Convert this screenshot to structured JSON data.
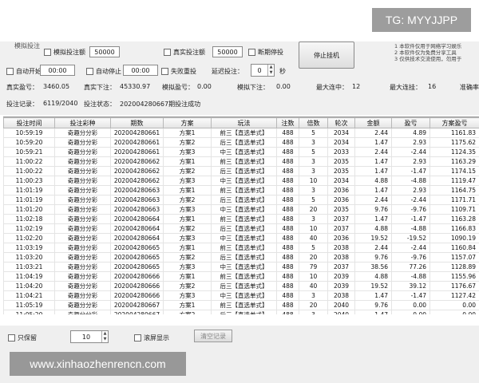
{
  "controls": {
    "top_cut_label": "模拟投注",
    "sim_bet_label": "模拟投注额",
    "sim_bet_value": "50000",
    "real_bet_label": "真实投注额",
    "real_bet_value": "50000",
    "stop_on_break_label": "断期停投",
    "auto_start_label": "自动开始",
    "auto_start_time": "00:00",
    "auto_stop_label": "自动停止",
    "auto_stop_time": "00:00",
    "fail_reset_label": "失败重投",
    "delay_label": "延迟投注：",
    "delay_value": "0",
    "delay_unit": "秒",
    "stop_button": "停止挂机"
  },
  "notes": [
    "1 本软件仅用于网络学习娱乐",
    "2 本软件仅为免费分享工具",
    "3 仅供技术交流使用，勿用于"
  ],
  "stats": {
    "real_profit_label": "真实盈亏：",
    "real_profit": "3460.05",
    "real_bet_label": "真实下注：",
    "real_bet": "45330.97",
    "sim_profit_label": "模拟盈亏：",
    "sim_profit": "0.00",
    "sim_bet_label": "模拟下注：",
    "sim_bet": "0.00",
    "max_miss_label": "最大连中：",
    "max_miss": "12",
    "max_hit_label": "最大连挂：",
    "max_hit": "16",
    "rate_label": "准确率"
  },
  "status": {
    "record_label": "投注记录：",
    "record_value": "6119/2040",
    "state_label": "投注状态：",
    "state_value": "202004280667期投注成功"
  },
  "table": {
    "columns": [
      "投注时间",
      "投注彩种",
      "期数",
      "方案",
      "玩法",
      "注数",
      "倍数",
      "轮次",
      "金额",
      "盈亏",
      "方案盈亏"
    ],
    "rows": [
      [
        "10:59:19",
        "奇趣分分彩",
        "202004280661",
        "方案1",
        "前三【直选单式】",
        "488",
        "5",
        "2034",
        "2.44",
        "4.89",
        "1161.83"
      ],
      [
        "10:59:20",
        "奇趣分分彩",
        "202004280661",
        "方案2",
        "后三【直选单式】",
        "488",
        "3",
        "2034",
        "1.47",
        "2.93",
        "1175.62"
      ],
      [
        "10:59:21",
        "奇趣分分彩",
        "202004280661",
        "方案3",
        "中三【直选单式】",
        "488",
        "5",
        "2033",
        "2.44",
        "-2.44",
        "1124.35"
      ],
      [
        "11:00:22",
        "奇趣分分彩",
        "202004280662",
        "方案1",
        "前三【直选单式】",
        "488",
        "3",
        "2035",
        "1.47",
        "2.93",
        "1163.29"
      ],
      [
        "11:00:22",
        "奇趣分分彩",
        "202004280662",
        "方案2",
        "后三【直选单式】",
        "488",
        "3",
        "2035",
        "1.47",
        "-1.47",
        "1174.15"
      ],
      [
        "11:00:23",
        "奇趣分分彩",
        "202004280662",
        "方案3",
        "中三【直选单式】",
        "488",
        "10",
        "2034",
        "4.88",
        "-4.88",
        "1119.47"
      ],
      [
        "11:01:19",
        "奇趣分分彩",
        "202004280663",
        "方案1",
        "前三【直选单式】",
        "488",
        "3",
        "2036",
        "1.47",
        "2.93",
        "1164.75"
      ],
      [
        "11:01:19",
        "奇趣分分彩",
        "202004280663",
        "方案2",
        "后三【直选单式】",
        "488",
        "5",
        "2036",
        "2.44",
        "-2.44",
        "1171.71"
      ],
      [
        "11:01:20",
        "奇趣分分彩",
        "202004280663",
        "方案3",
        "中三【直选单式】",
        "488",
        "20",
        "2035",
        "9.76",
        "-9.76",
        "1109.71"
      ],
      [
        "11:02:18",
        "奇趣分分彩",
        "202004280664",
        "方案1",
        "前三【直选单式】",
        "488",
        "3",
        "2037",
        "1.47",
        "-1.47",
        "1163.28"
      ],
      [
        "11:02:19",
        "奇趣分分彩",
        "202004280664",
        "方案2",
        "后三【直选单式】",
        "488",
        "10",
        "2037",
        "4.88",
        "-4.88",
        "1166.83"
      ],
      [
        "11:02:20",
        "奇趣分分彩",
        "202004280664",
        "方案3",
        "中三【直选单式】",
        "488",
        "40",
        "2036",
        "19.52",
        "-19.52",
        "1090.19"
      ],
      [
        "11:03:19",
        "奇趣分分彩",
        "202004280665",
        "方案1",
        "前三【直选单式】",
        "488",
        "5",
        "2038",
        "2.44",
        "-2.44",
        "1160.84"
      ],
      [
        "11:03:20",
        "奇趣分分彩",
        "202004280665",
        "方案2",
        "后三【直选单式】",
        "488",
        "20",
        "2038",
        "9.76",
        "-9.76",
        "1157.07"
      ],
      [
        "11:03:21",
        "奇趣分分彩",
        "202004280665",
        "方案3",
        "中三【直选单式】",
        "488",
        "79",
        "2037",
        "38.56",
        "77.26",
        "1128.89"
      ],
      [
        "11:04:19",
        "奇趣分分彩",
        "202004280666",
        "方案1",
        "前三【直选单式】",
        "488",
        "10",
        "2039",
        "4.88",
        "-4.88",
        "1155.96"
      ],
      [
        "11:04:20",
        "奇趣分分彩",
        "202004280666",
        "方案2",
        "后三【直选单式】",
        "488",
        "40",
        "2039",
        "19.52",
        "39.12",
        "1176.67"
      ],
      [
        "11:04:21",
        "奇趣分分彩",
        "202004280666",
        "方案3",
        "中三【直选单式】",
        "488",
        "3",
        "2038",
        "1.47",
        "-1.47",
        "1127.42"
      ],
      [
        "11:05:19",
        "奇趣分分彩",
        "202004280667",
        "方案1",
        "前三【直选单式】",
        "488",
        "20",
        "2040",
        "9.76",
        "0.00",
        "0.00"
      ],
      [
        "11:05:20",
        "奇趣分分彩",
        "202004280667",
        "方案2",
        "后三【直选单式】",
        "488",
        "3",
        "2040",
        "1.47",
        "0.00",
        "0.00"
      ],
      [
        "11:05:21",
        "奇趣分分彩",
        "202004280667",
        "方案3",
        "中三【直选单式】",
        "488",
        "5",
        "2039",
        "2.44",
        "0.00",
        "0.00"
      ]
    ]
  },
  "bottom": {
    "keep_records_label": "只保留",
    "keep_records_value": "10",
    "display_label": "滚屏显示",
    "disabled_button": "清空记录"
  },
  "watermarks": {
    "top": "TG: MYYJJPP",
    "bottom": "www.xinhaozhenrencn.com"
  }
}
